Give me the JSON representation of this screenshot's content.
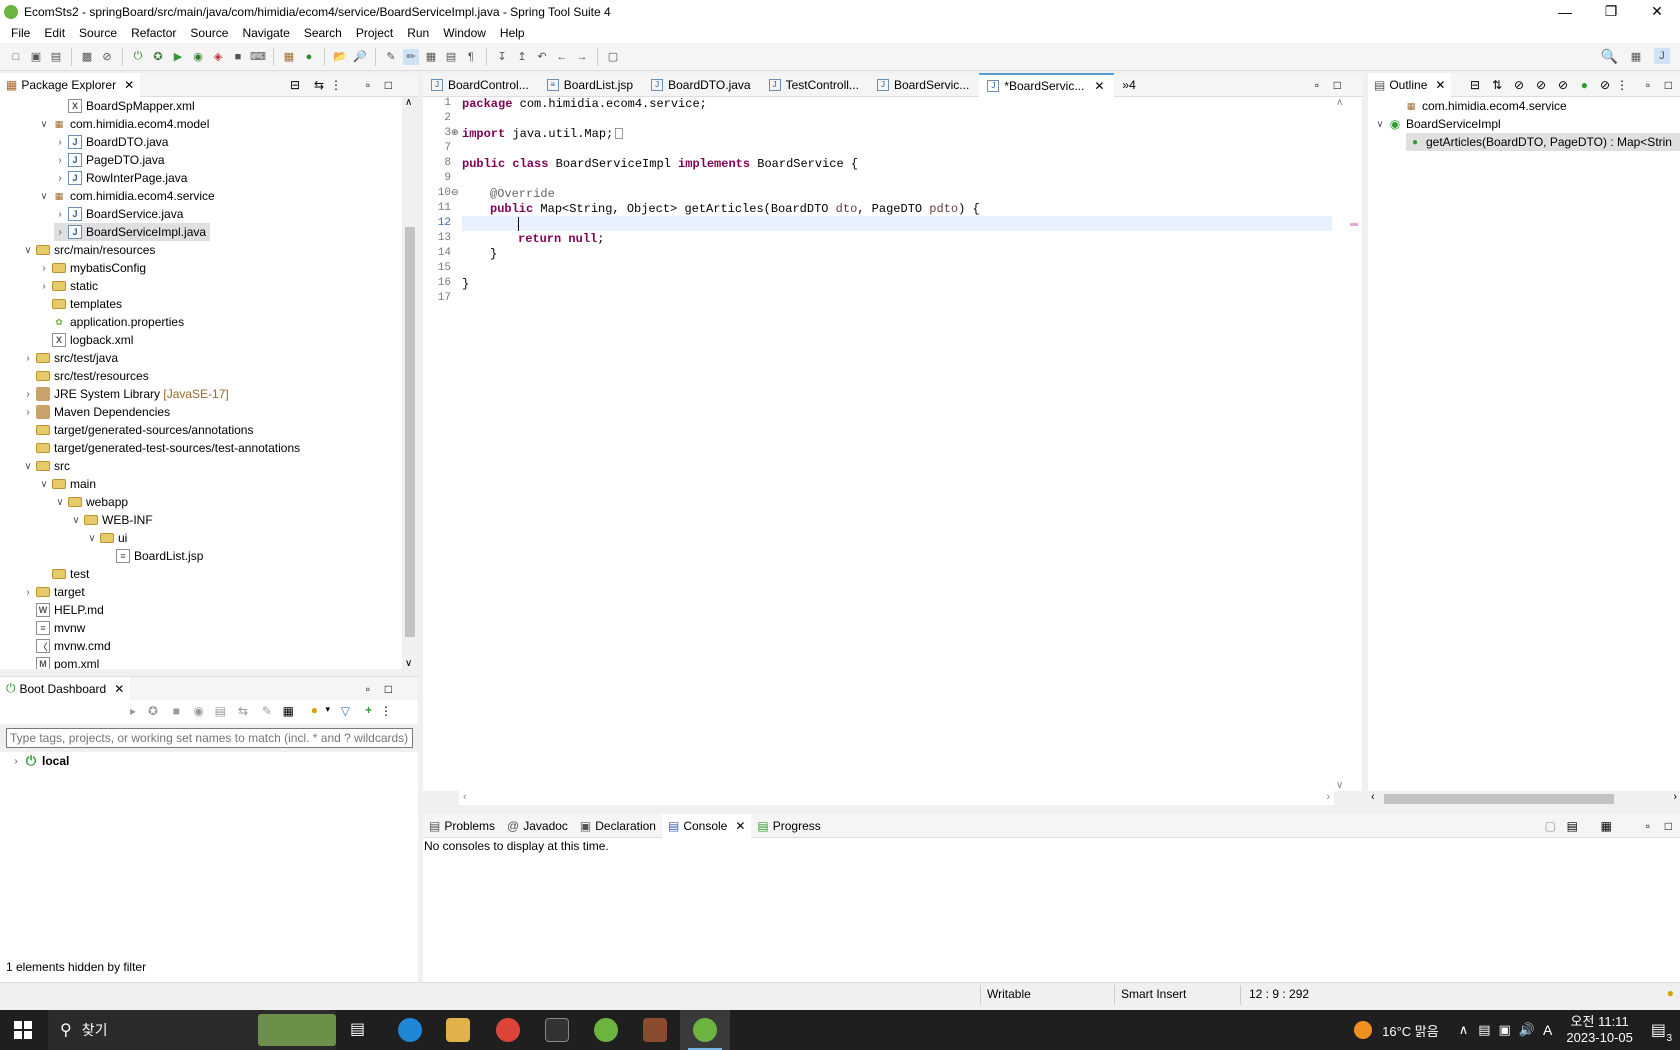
{
  "window": {
    "title": "EcomSts2 - springBoard/src/main/java/com/himidia/ecom4/service/BoardServiceImpl.java - Spring Tool Suite 4"
  },
  "menu": [
    "File",
    "Edit",
    "Source",
    "Refactor",
    "Source",
    "Navigate",
    "Search",
    "Project",
    "Run",
    "Window",
    "Help"
  ],
  "package_explorer": {
    "tab_label": "Package Explorer",
    "items": [
      "BoardSpMapper.xml",
      "com.himidia.ecom4.model",
      "BoardDTO.java",
      "PageDTO.java",
      "RowInterPage.java",
      "com.himidia.ecom4.service",
      "BoardService.java",
      "BoardServiceImpl.java",
      "src/main/resources",
      "mybatisConfig",
      "static",
      "templates",
      "application.properties",
      "logback.xml",
      "src/test/java",
      "src/test/resources",
      "JRE System Library",
      "Maven Dependencies",
      "target/generated-sources/annotations",
      "target/generated-test-sources/test-annotations",
      "src",
      "main",
      "webapp",
      "WEB-INF",
      "ui",
      "BoardList.jsp",
      "test",
      "target",
      "HELP.md",
      "mvnw",
      "mvnw.cmd",
      "pom.xml"
    ],
    "jre_suffix": "[JavaSE-17]"
  },
  "boot_dashboard": {
    "tab_label": "Boot Dashboard",
    "filter_placeholder": "Type tags, projects, or working set names to match (incl. * and ? wildcards)",
    "local_label": "local",
    "footer": "1 elements hidden by filter"
  },
  "editor": {
    "tabs": [
      "BoardControl...",
      "BoardList.jsp",
      "BoardDTO.java",
      "TestControll...",
      "BoardServic...",
      "*BoardServic..."
    ],
    "overflow_count": "»4",
    "line_numbers": [
      "1",
      "2",
      "3",
      "7",
      "8",
      "9",
      "10",
      "11",
      "12",
      "13",
      "14",
      "15",
      "16",
      "17"
    ],
    "code": {
      "l1_kw": "package",
      "l1_rest": " com.himidia.ecom4.service;",
      "l3_kw": "import",
      "l3_rest": " java.util.Map;",
      "l8_kw1": "public class",
      "l8_mid": " BoardServiceImpl ",
      "l8_kw2": "implements",
      "l8_rest": " BoardService {",
      "l10_ann": "@Override",
      "l11_kw": "public",
      "l11_a": " Map<String, Object> getArticles(BoardDTO ",
      "l11_v1": "dto",
      "l11_b": ", PageDTO ",
      "l11_v2": "pdto",
      "l11_c": ") {",
      "l13_kw1": "return",
      "l13_kw2": "null",
      "l13_rest": ";",
      "l14": "}",
      "l16": "}"
    }
  },
  "outline": {
    "tab_label": "Outline",
    "items": [
      "com.himidia.ecom4.service",
      "BoardServiceImpl",
      "getArticles(BoardDTO, PageDTO) : Map<Strin"
    ]
  },
  "console": {
    "tabs": [
      "Problems",
      "Javadoc",
      "Declaration",
      "Console",
      "Progress"
    ],
    "message": "No consoles to display at this time."
  },
  "status": {
    "writable": "Writable",
    "insert_mode": "Smart Insert",
    "position": "12 : 9 : 292"
  },
  "taskbar": {
    "search_label": "찾기",
    "weather": "16°C 맑음",
    "time": "오전 11:11",
    "date": "2023-10-05",
    "notif_count": "3",
    "ime": "A"
  }
}
